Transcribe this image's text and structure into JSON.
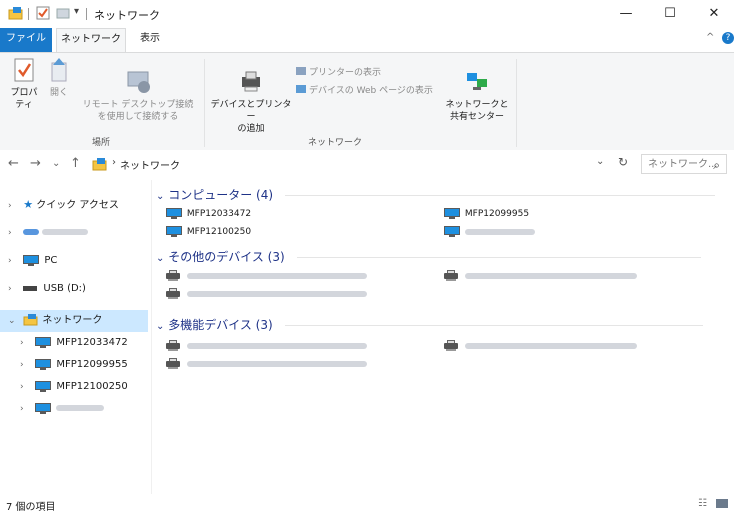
{
  "window": {
    "title": "ネットワーク",
    "minimize": "—",
    "maximize": "☐",
    "close": "✕"
  },
  "ribbon_tabs": {
    "file": "ファイル",
    "network": "ネットワーク",
    "view": "表示"
  },
  "ribbon": {
    "properties": "プロパティ",
    "open": "開く",
    "remote_desktop": "リモート デスクトップ接続\nを使用して接続する",
    "location_group": "場所",
    "add_devices": "デバイスとプリンター\nの追加",
    "view_printers": "プリンターの表示",
    "view_device_web": "デバイスの Web ページの表示",
    "network_center": "ネットワークと\n共有センター",
    "network_group": "ネットワーク"
  },
  "address": {
    "back": "←",
    "forward": "→",
    "recent": "⌄",
    "up": "↑",
    "path": "ネットワーク",
    "refresh": "↻",
    "search_placeholder": "ネットワーク...",
    "search_icon": "⌕"
  },
  "nav": {
    "quick_access": "クイック アクセス",
    "pc": "PC",
    "usb": "USB (D:)",
    "network": "ネットワーク",
    "children": [
      "MFP12033472",
      "MFP12099955",
      "MFP12100250"
    ]
  },
  "groups": {
    "computers": "コンピューター (4)",
    "other_devices": "その他のデバイス (3)",
    "multifunction": "多機能デバイス (3)"
  },
  "computers": [
    "MFP12033472",
    "MFP12099955",
    "MFP12100250"
  ],
  "status": {
    "item_count": "7 個の項目"
  },
  "colors": {
    "accent": "#1979ca",
    "group_header": "#1e3287",
    "selection": "#cce8ff"
  }
}
